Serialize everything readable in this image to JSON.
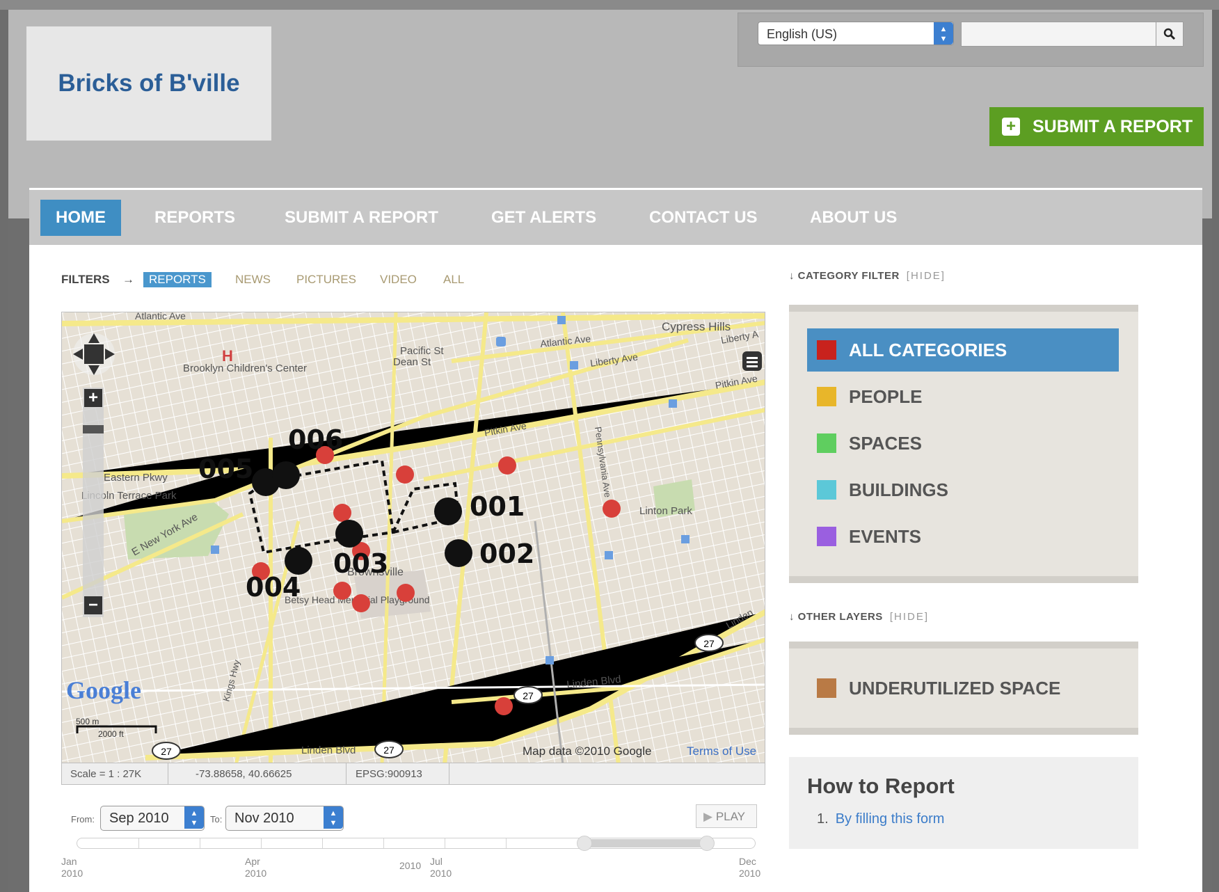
{
  "site": {
    "title": "Bricks of B'ville"
  },
  "header": {
    "language": "English (US)",
    "search_placeholder": "",
    "submit_button": "SUBMIT A REPORT"
  },
  "nav": {
    "items": [
      "HOME",
      "REPORTS",
      "SUBMIT A REPORT",
      "GET ALERTS",
      "CONTACT US",
      "ABOUT US"
    ],
    "active": "HOME"
  },
  "filters": {
    "label": "FILTERS",
    "arrow": "→",
    "options": [
      "REPORTS",
      "NEWS",
      "PICTURES",
      "VIDEO",
      "ALL"
    ],
    "active": "REPORTS"
  },
  "map": {
    "labels": {
      "atlantic_ave_top": "Atlantic Ave",
      "pacific_st": "Pacific St",
      "dean_st": "Dean St",
      "atlantic_ave": "Atlantic Ave",
      "cypress_hills": "Cypress Hills",
      "liberty_ave": "Liberty Ave",
      "liberty_a": "Liberty A",
      "pitkin_ave_right": "Pitkin Ave",
      "pitkin_ave": "Pitkin Ave",
      "brooklyn_childrens": "Brooklyn Children's Center",
      "eastern_pkwy": "Eastern Pkwy",
      "lincoln_terrace": "Lincoln Terrace Park",
      "e_new_york_ave": "E New York Ave",
      "pennsylvania_ave": "Pennsylvania Ave",
      "linton_park": "Linton Park",
      "brownsville": "Brownsville",
      "betsy_head": "Betsy Head Memorial Playground",
      "linden_blvd": "Linden Blvd",
      "linden_blvd_bottom": "Linden Blvd",
      "kings_hwy": "Kings Hwy",
      "linden": "Linden",
      "route": "27",
      "scale_500m": "500 m",
      "scale_2000ft": "2000 ft",
      "copyright": "Map data ©2010 Google",
      "terms": "Terms of Use",
      "google": "Google"
    },
    "report_ids": [
      "001",
      "002",
      "003",
      "004",
      "005",
      "006"
    ]
  },
  "status_bar": {
    "scale": "Scale = 1 : 27K",
    "coords": "-73.88658, 40.66625",
    "epsg": "EPSG:900913"
  },
  "timeline": {
    "from_label": "From:",
    "from_value": "Sep 2010",
    "to_label": "To:",
    "to_value": "Nov 2010",
    "play": "PLAY",
    "axis_left_month": "Jan",
    "axis_left_year": "2010",
    "axis_apr": "Apr",
    "axis_apr_year": "2010",
    "axis_jul": "Jul",
    "axis_jul_year": "2010",
    "axis_mid_year": "2010",
    "axis_dec": "Dec",
    "axis_dec_year": "2010"
  },
  "sidebar": {
    "category_heading": "CATEGORY FILTER",
    "category_hide": "[HIDE]",
    "categories": [
      {
        "label": "ALL CATEGORIES",
        "color": "#c8221d",
        "active": true
      },
      {
        "label": "PEOPLE",
        "color": "#e8b62a",
        "active": false
      },
      {
        "label": "SPACES",
        "color": "#5fce5f",
        "active": false
      },
      {
        "label": "BUILDINGS",
        "color": "#5cc8d8",
        "active": false
      },
      {
        "label": "EVENTS",
        "color": "#9a5fe0",
        "active": false
      }
    ],
    "layers_heading": "OTHER LAYERS",
    "layers_hide": "[HIDE]",
    "layers": [
      {
        "label": "UNDERUTILIZED SPACE",
        "color": "#b97a45"
      }
    ],
    "howto_title": "How to Report",
    "howto_number": "1.",
    "howto_item": "By filling this form"
  },
  "colors": {
    "accent": "#3f8ec3",
    "submit_green": "#5c9e22",
    "marker_red": "#d8403a"
  }
}
